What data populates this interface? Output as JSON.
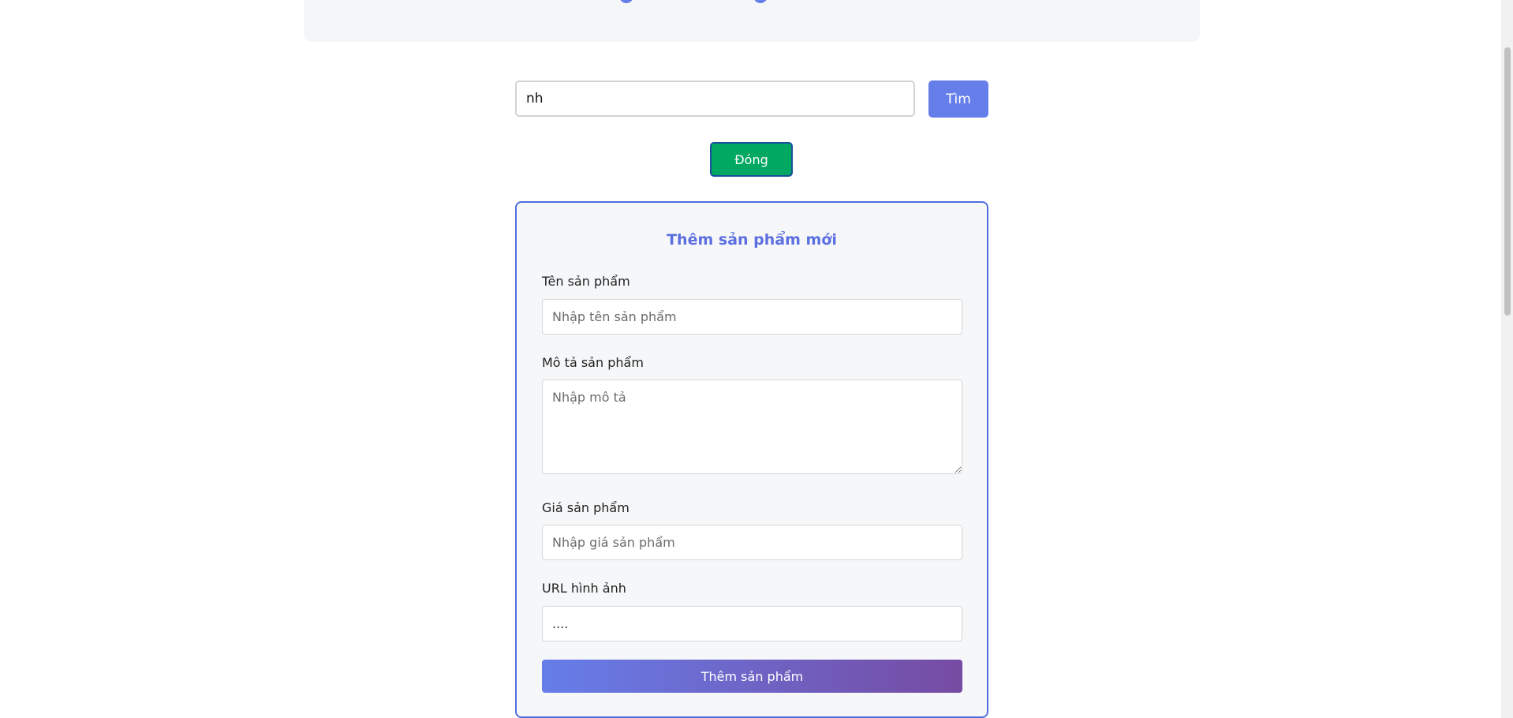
{
  "search": {
    "value": "nh",
    "button_label": "Tìm"
  },
  "close_button_label": "Đóng",
  "form": {
    "title": "Thêm sản phẩm mới",
    "name_label": "Tên sản phẩm",
    "name_placeholder": "Nhập tên sản phẩm",
    "description_label": "Mô tả sản phẩm",
    "description_placeholder": "Nhập mô tả",
    "price_label": "Giá sản phẩm",
    "price_placeholder": "Nhập giá sản phẩm",
    "image_label": "URL hình ảnh",
    "image_value": "....",
    "submit_label": "Thêm sản phẩm"
  },
  "colors": {
    "accent": "#667eea",
    "accent_gradient_end": "#764ba2",
    "close_button": "#00a862",
    "card_border": "#4f6fe0"
  }
}
